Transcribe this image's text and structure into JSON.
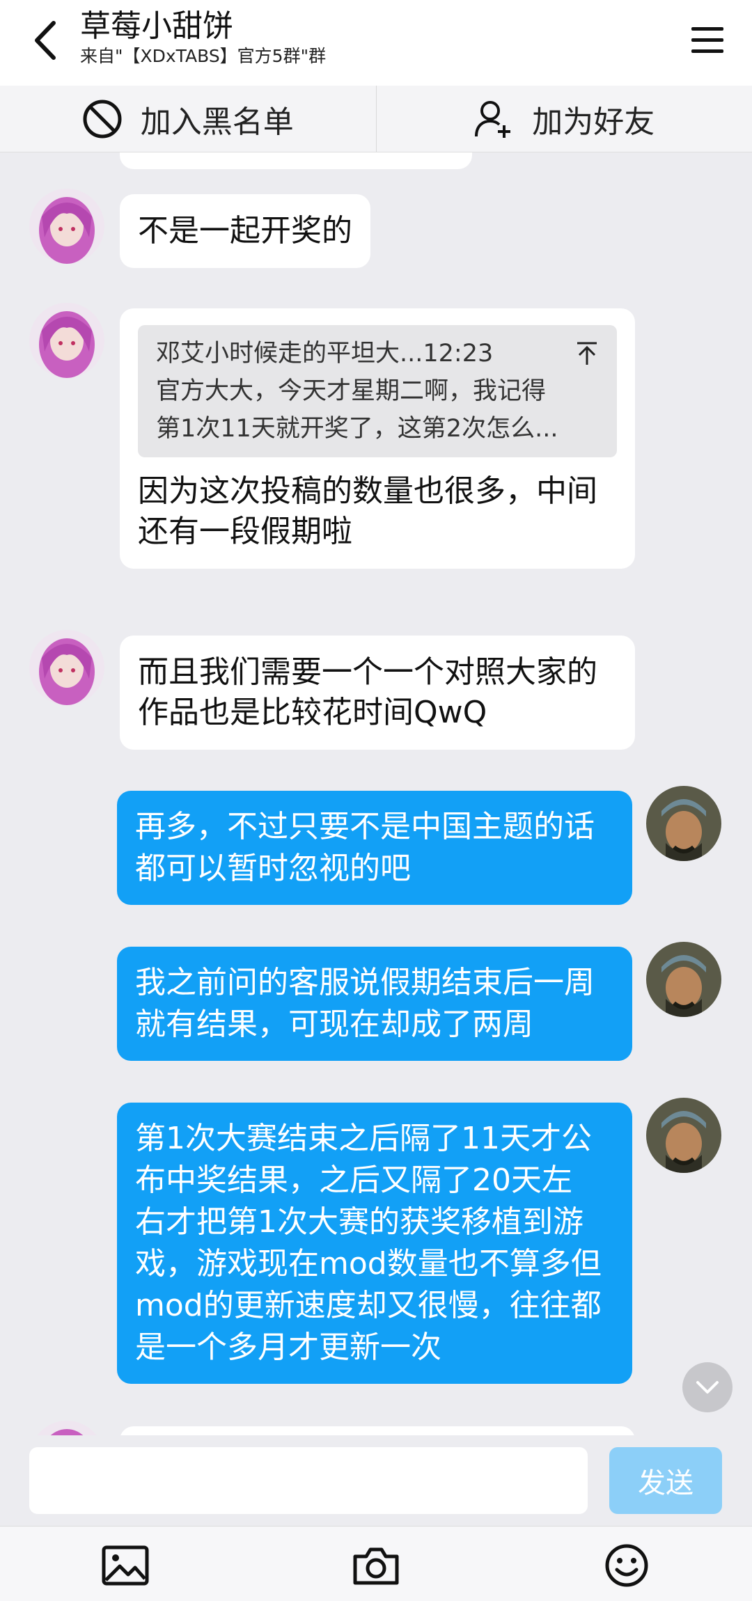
{
  "header": {
    "title": "草莓小甜饼",
    "subtitle": "来自\"【XDxTABS】官方5群\"群"
  },
  "actions": {
    "block_label": "加入黑名单",
    "add_friend_label": "加为好友"
  },
  "messages": [
    {
      "side": "in",
      "text": "不是一起开奖的"
    },
    {
      "side": "in",
      "quote": {
        "author_time": "邓艾小时候走的平坦大...12:23",
        "line1": "官方大大，今天才星期二啊，我记得",
        "line2": "第1次11天就开奖了，这第2次怎么..."
      },
      "line1": "因为这次投稿的数量也很多，中间",
      "line2": "还有一段假期啦"
    },
    {
      "side": "in",
      "line1": "而且我们需要一个一个对照大家的",
      "line2": "作品也是比较花时间QwQ"
    },
    {
      "side": "out",
      "line1": "再多，不过只要不是中国主题的话",
      "line2": "都可以暂时忽视的吧"
    },
    {
      "side": "out",
      "line1": "我之前问的客服说假期结束后一周",
      "line2": "就有结果，可现在却成了两周"
    },
    {
      "side": "out",
      "lines": [
        "第1次大赛结束之后隔了11天才公",
        "布中奖结果，之后又隔了20天左",
        "右才把第1次大赛的获奖移植到游",
        "戏，游戏现在mod数量也不算多但",
        "mod的更新速度却又很慢，往往都",
        "是一个多月才更新一次"
      ]
    }
  ],
  "input": {
    "placeholder": "",
    "send_label": "发送"
  },
  "colors": {
    "outgoing_bubble": "#12a0f6",
    "incoming_bubble": "#ffffff",
    "send_disabled": "#8ccff8"
  },
  "icons": {
    "back": "chevron-left-icon",
    "menu": "hamburger-menu-icon",
    "block": "block-icon",
    "add_friend": "add-user-icon",
    "pin_top": "to-top-icon",
    "scroll": "chevron-down-icon",
    "image": "image-icon",
    "camera": "camera-icon",
    "emoji": "emoji-icon"
  }
}
